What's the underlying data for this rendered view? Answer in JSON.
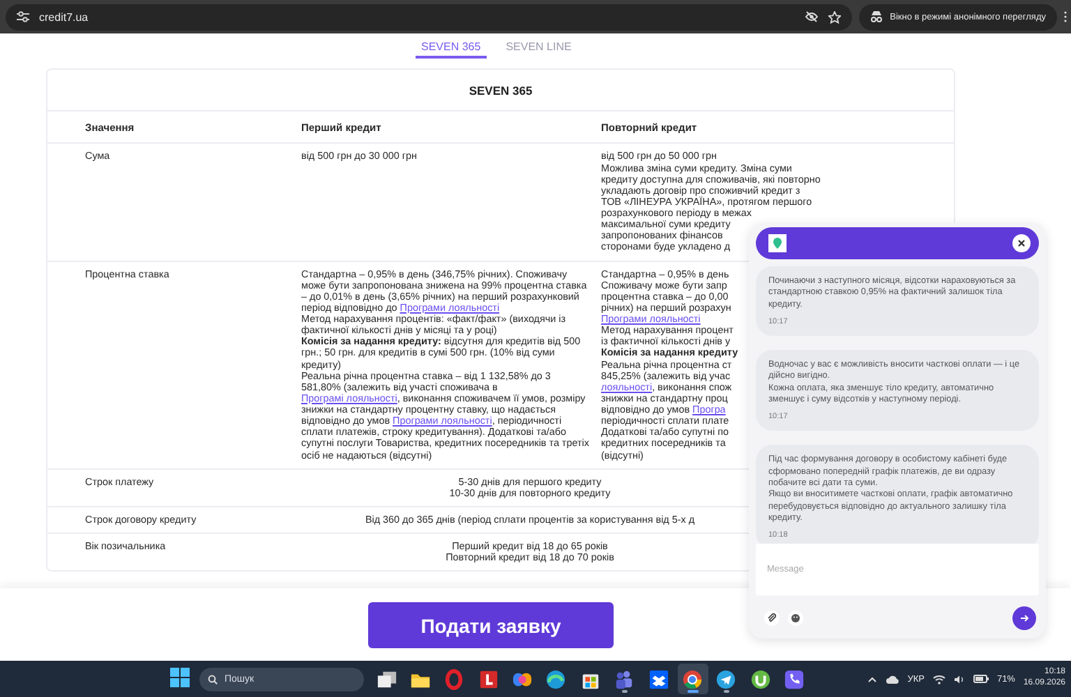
{
  "browser": {
    "url": "credit7.ua",
    "incognito_label": "Вікно в режимі анонімного перегляду"
  },
  "tabs": [
    {
      "label": "SEVEN 365",
      "selected": true
    },
    {
      "label": "SEVEN LINE",
      "selected": false
    }
  ],
  "card": {
    "title": "SEVEN 365",
    "columns": [
      "Значення",
      "Перший кредит",
      "Повторний кредит"
    ],
    "rows": [
      {
        "label": "Сума",
        "cells": [
          {
            "paragraphs": [
              "від 500 грн до 30 000 грн"
            ]
          },
          {
            "lines": [
              "від 500 грн до 50 000 грн",
              "Можлива зміна суми кредиту. Зміна суми",
              "кредиту доступна для споживачів, які повторно",
              "укладають договір про споживчий кредит з",
              "ТОВ «ЛІНЕУРА УКРАЇНА», протягом першого",
              "розрахункового періоду в межах",
              "максимальної суми кредиту",
              "запропонованих фінансов",
              "сторонами буде укладено д"
            ]
          }
        ]
      },
      {
        "label": "Процентна ставка",
        "cells": [
          {
            "paragraphs": [
              [
                {
                  "kind": "text",
                  "text": "Стандартна – 0,95% в день (346,75% річних). Споживачу може бути запропонована знижена на 99% процентна ставка – до 0,01% в день (3,65% річних) на перший розрахунковий період відповідно до "
                },
                {
                  "kind": "link",
                  "text": "Програми лояльності"
                }
              ],
              "Метод нарахування процентів: «факт/факт» (виходячи із фактичної кількості днів у місяці та у році)",
              "**Комісія за надання кредиту:** відсутня для кредитів від 500 грн.; 50 грн. для кредитів в сумі 500 грн. (10% від суми кредиту)",
              [
                {
                  "kind": "text",
                  "text": "Реальна річна процентна ставка – від 1 132,58% до 3 581,80% (залежить від участі споживача в "
                },
                {
                  "kind": "link",
                  "text": "Програмі лояльності"
                },
                {
                  "kind": "text",
                  "text": ", виконання споживачем її умов, розміру знижки на стандартну процентну ставку, що надається відповідно до умов "
                },
                {
                  "kind": "link",
                  "text": "Програми лояльності"
                },
                {
                  "kind": "text",
                  "text": ", періодичності сплати платежів, строку кредитування). Додаткові та/або супутні послуги Товариства, кредитних посередників та третіх осіб не надаються (відсутні)"
                }
              ]
            ]
          },
          {
            "lines": [
              "Стандартна – 0,95% в день",
              "Споживачу може бути запр",
              "процентна ставка – до 0,00",
              "річних) на перший розрахун",
              [
                {
                  "kind": "link",
                  "text": "Програми лояльності"
                }
              ],
              "Метод нарахування процент",
              "із фактичної кількості днів у",
              "**Комісія за надання кредиту**",
              "Реальна річна процентна ст",
              "845,25% (залежить від учас",
              [
                {
                  "kind": "link",
                  "text": "лояльності"
                },
                {
                  "kind": "text",
                  "text": ", виконання спож"
                }
              ],
              "знижки на стандартну проц",
              [
                {
                  "kind": "text",
                  "text": "відповідно до умов "
                },
                {
                  "kind": "link",
                  "text": "Програ"
                }
              ],
              "періодичності сплати плате",
              "Додаткові та/або супутні по",
              "кредитних посередників та",
              "(відсутні)"
            ]
          }
        ]
      },
      {
        "label": "Строк платежу",
        "span": [
          "5-30 днів для першого кредиту",
          "10-30 днів для повторного кредиту"
        ]
      },
      {
        "label": "Строк договору кредиту",
        "span": [
          "Від 360 до 365 днів (період сплати процентів за користування від 5-х д"
        ]
      },
      {
        "label": "Вік позичальника",
        "span": [
          "Перший кредит від 18 до 65 років",
          "Повторний кредит від 18 до 70 років"
        ]
      }
    ]
  },
  "footer": {
    "button": "Подати заявку"
  },
  "chat": {
    "messages": [
      {
        "text": "Починаючи з наступного місяця, відсотки нараховуються за стандартною ставкою 0,95% на фактичний залишок тіла кредиту.",
        "time": "10:17"
      },
      {
        "text": "Водночас у вас є можливість вносити часткові оплати — і це дійсно вигідно.\nКожна оплата, яка зменшує тіло кредиту, автоматично зменшує і суму відсотків у наступному періоді.",
        "time": "10:17"
      },
      {
        "text": "Під час формування договору в особистому кабінеті буде сформовано попередній графік платежів, де ви одразу побачите всі дати та суми.\nЯкщо ви вноситимете часткові оплати, графік автоматично перебудовується відповідно до актуального залишку тіла кредиту.",
        "time": "10:18"
      }
    ],
    "input": {
      "placeholder": "Message"
    }
  },
  "taskbar": {
    "search_placeholder": "Пошук",
    "apps": [
      {
        "kind": "taskview",
        "running": false,
        "selected": false
      },
      {
        "kind": "folder",
        "running": false,
        "selected": false
      },
      {
        "kind": "ring",
        "running": false,
        "selected": false
      },
      {
        "kind": "tile",
        "running": false,
        "selected": false
      },
      {
        "kind": "swirl",
        "running": false,
        "selected": false
      },
      {
        "kind": "wave",
        "running": false,
        "selected": false
      },
      {
        "kind": "store",
        "running": false,
        "selected": false
      },
      {
        "kind": "people",
        "running": true,
        "selected": false
      },
      {
        "kind": "box",
        "running": false,
        "selected": false
      },
      {
        "kind": "wheel",
        "running": true,
        "selected": true
      },
      {
        "kind": "plane",
        "running": true,
        "selected": false
      },
      {
        "kind": "leaf",
        "running": false,
        "selected": false
      },
      {
        "kind": "phone",
        "running": false,
        "selected": false
      }
    ],
    "language": "УКР",
    "battery": "71%",
    "time": "10:18",
    "date": "16.09.2026"
  }
}
